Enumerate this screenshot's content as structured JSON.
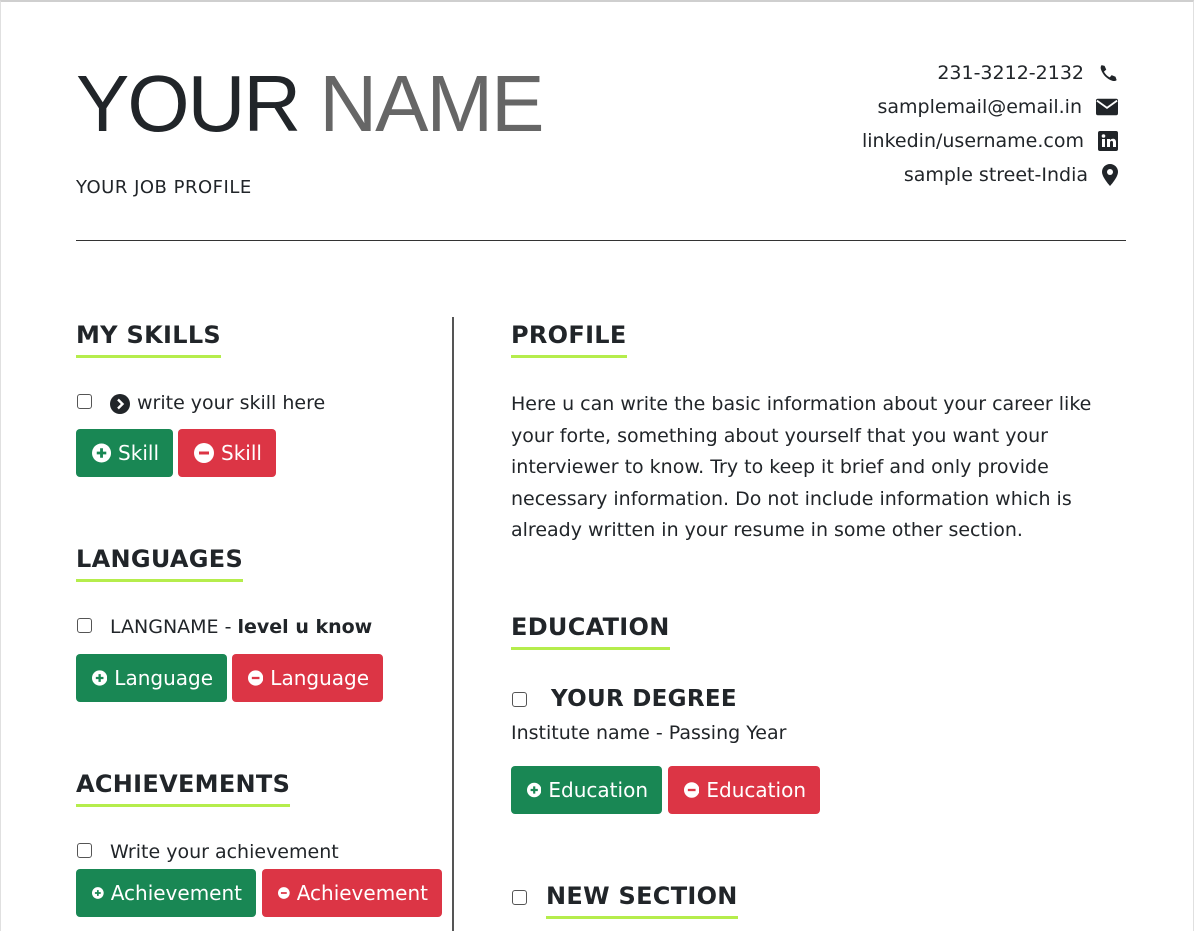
{
  "header": {
    "name_first": "YOUR",
    "name_last": "NAME",
    "job_profile": "YOUR JOB PROFILE",
    "contacts": [
      {
        "text": "231-3212-2132",
        "icon": "phone-icon"
      },
      {
        "text": "samplemail@email.in",
        "icon": "envelope-icon"
      },
      {
        "text": "linkedin/username.com",
        "icon": "linkedin-icon"
      },
      {
        "text": "sample street-India",
        "icon": "map-marker-icon"
      }
    ]
  },
  "skills": {
    "title": "MY SKILLS",
    "items": [
      {
        "text": "write your skill here",
        "icon": "chevron-circle-right-icon"
      }
    ],
    "add_label": "Skill",
    "remove_label": "Skill"
  },
  "languages": {
    "title": "LANGUAGES",
    "items": [
      {
        "name": "LANGNAME",
        "separator": " - ",
        "level": "level u know"
      }
    ],
    "add_label": "Language",
    "remove_label": "Language"
  },
  "achievements": {
    "title": "ACHIEVEMENTS",
    "items": [
      {
        "text": "Write your achievement"
      }
    ],
    "add_label": "Achievement",
    "remove_label": "Achievement"
  },
  "profile": {
    "title": "PROFILE",
    "text": "Here u can write the basic information about your career like your forte, something about yourself that you want your interviewer to know. Try to keep it brief and only provide necessary information. Do not include information which is already written in your resume in some other section."
  },
  "education": {
    "title": "EDUCATION",
    "items": [
      {
        "degree": "YOUR DEGREE",
        "institute": "Institute name - Passing Year"
      }
    ],
    "add_label": "Education",
    "remove_label": "Education"
  },
  "new_section": {
    "title": "NEW SECTION"
  },
  "colors": {
    "accent_underline": "#b5ed4c",
    "add_button": "#198754",
    "remove_button": "#dc3545",
    "text": "#212529",
    "name_last": "#666666"
  }
}
